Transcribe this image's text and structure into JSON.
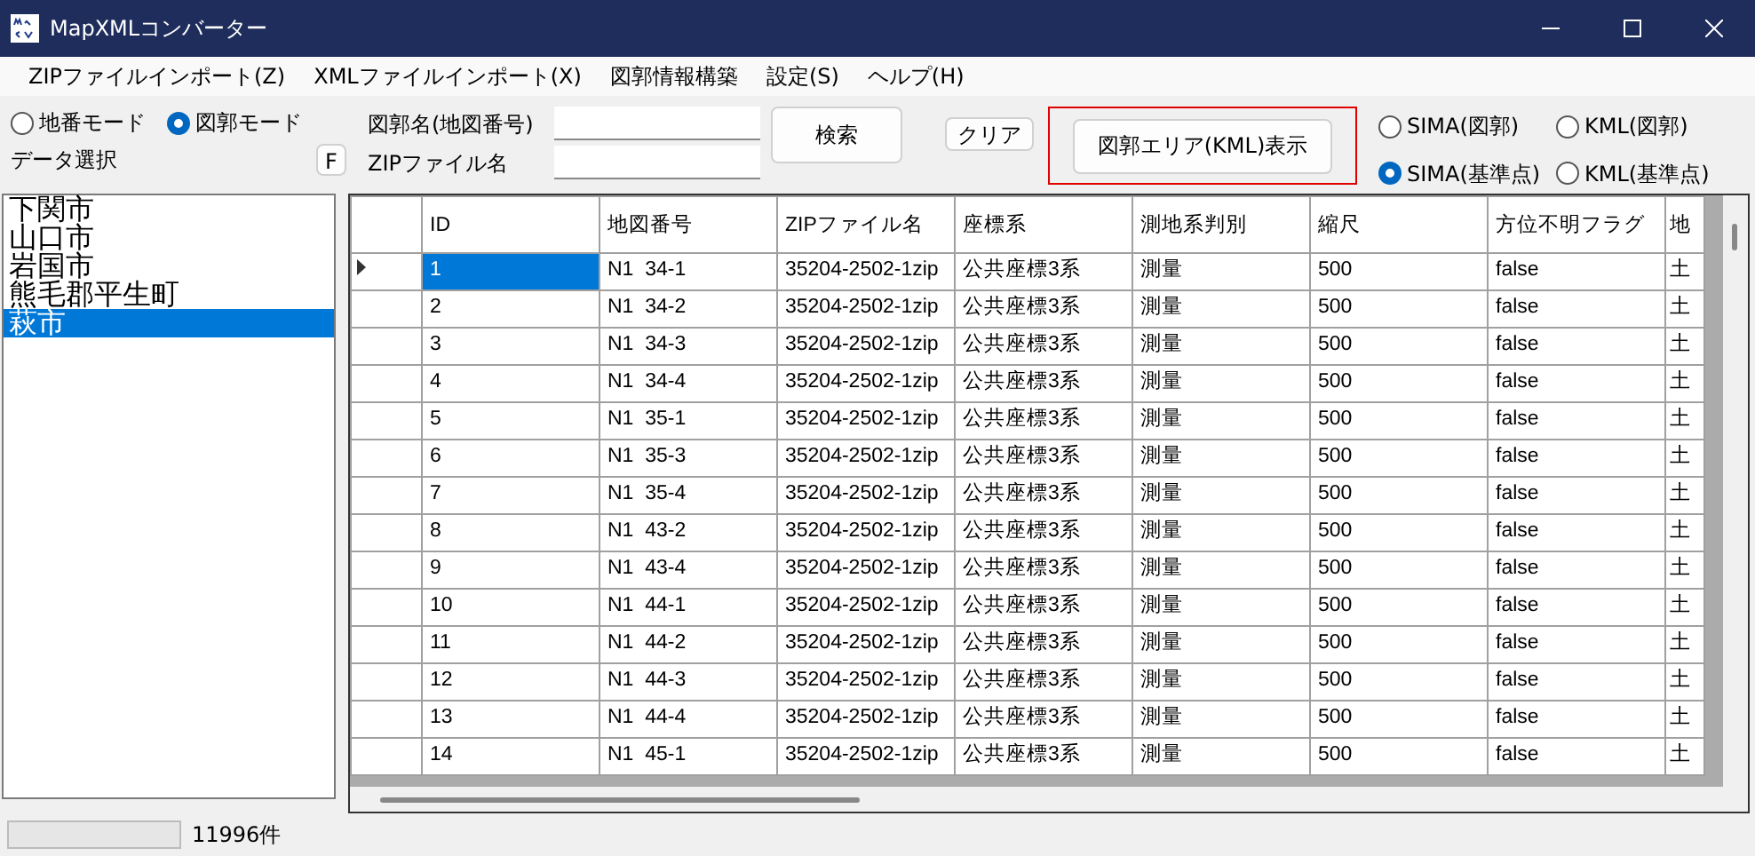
{
  "window": {
    "title": "MapXMLコンバーター"
  },
  "menu": [
    "ZIPファイルインポート(Z)",
    "XMLファイルインポート(X)",
    "図郭情報構築",
    "設定(S)",
    "ヘルプ(H)"
  ],
  "mode_options": [
    {
      "label": "地番モード",
      "selected": false
    },
    {
      "label": "図郭モード",
      "selected": true
    }
  ],
  "data_select": {
    "label": "データ選択",
    "button": "F"
  },
  "fields": [
    {
      "label": "図郭名(地図番号)"
    },
    {
      "label": "ZIPファイル名"
    }
  ],
  "search_button": "検索",
  "clear_button": "クリア",
  "kml_button": {
    "label": "図郭エリア(KML)表示",
    "highlighted": true
  },
  "output_options": [
    {
      "label": "SIMA(図郭)",
      "selected": false
    },
    {
      "label": "KML(図郭)",
      "selected": false
    },
    {
      "label": "SIMA(基準点)",
      "selected": true
    },
    {
      "label": "KML(基準点)",
      "selected": false
    }
  ],
  "city_list": [
    {
      "label": "下関市",
      "selected": false
    },
    {
      "label": "山口市",
      "selected": false
    },
    {
      "label": "岩国市",
      "selected": false
    },
    {
      "label": "熊毛郡平生町",
      "selected": false
    },
    {
      "label": "萩市",
      "selected": true
    }
  ],
  "table": {
    "columns": [
      "ID",
      "地図番号",
      "ZIPファイル名",
      "座標系",
      "測地系判別",
      "縮尺",
      "方位不明フラグ",
      "地"
    ],
    "rows": [
      {
        "selected": true,
        "cells": [
          "1",
          "N1  34-1",
          "35204-2502-1zip",
          "公共座標3系",
          "測量",
          "500",
          "false",
          "土"
        ]
      },
      {
        "selected": false,
        "cells": [
          "2",
          "N1  34-2",
          "35204-2502-1zip",
          "公共座標3系",
          "測量",
          "500",
          "false",
          "土"
        ]
      },
      {
        "selected": false,
        "cells": [
          "3",
          "N1  34-3",
          "35204-2502-1zip",
          "公共座標3系",
          "測量",
          "500",
          "false",
          "土"
        ]
      },
      {
        "selected": false,
        "cells": [
          "4",
          "N1  34-4",
          "35204-2502-1zip",
          "公共座標3系",
          "測量",
          "500",
          "false",
          "土"
        ]
      },
      {
        "selected": false,
        "cells": [
          "5",
          "N1  35-1",
          "35204-2502-1zip",
          "公共座標3系",
          "測量",
          "500",
          "false",
          "土"
        ]
      },
      {
        "selected": false,
        "cells": [
          "6",
          "N1  35-3",
          "35204-2502-1zip",
          "公共座標3系",
          "測量",
          "500",
          "false",
          "土"
        ]
      },
      {
        "selected": false,
        "cells": [
          "7",
          "N1  35-4",
          "35204-2502-1zip",
          "公共座標3系",
          "測量",
          "500",
          "false",
          "土"
        ]
      },
      {
        "selected": false,
        "cells": [
          "8",
          "N1  43-2",
          "35204-2502-1zip",
          "公共座標3系",
          "測量",
          "500",
          "false",
          "土"
        ]
      },
      {
        "selected": false,
        "cells": [
          "9",
          "N1  43-4",
          "35204-2502-1zip",
          "公共座標3系",
          "測量",
          "500",
          "false",
          "土"
        ]
      },
      {
        "selected": false,
        "cells": [
          "10",
          "N1  44-1",
          "35204-2502-1zip",
          "公共座標3系",
          "測量",
          "500",
          "false",
          "土"
        ]
      },
      {
        "selected": false,
        "cells": [
          "11",
          "N1  44-2",
          "35204-2502-1zip",
          "公共座標3系",
          "測量",
          "500",
          "false",
          "土"
        ]
      },
      {
        "selected": false,
        "cells": [
          "12",
          "N1  44-3",
          "35204-2502-1zip",
          "公共座標3系",
          "測量",
          "500",
          "false",
          "土"
        ]
      },
      {
        "selected": false,
        "cells": [
          "13",
          "N1  44-4",
          "35204-2502-1zip",
          "公共座標3系",
          "測量",
          "500",
          "false",
          "土"
        ]
      },
      {
        "selected": false,
        "cells": [
          "14",
          "N1  45-1",
          "35204-2502-1zip",
          "公共座標3系",
          "測量",
          "500",
          "false",
          "土"
        ]
      }
    ]
  },
  "status_bar": {
    "progress": {
      "level": 0
    },
    "count": "11996件"
  }
}
